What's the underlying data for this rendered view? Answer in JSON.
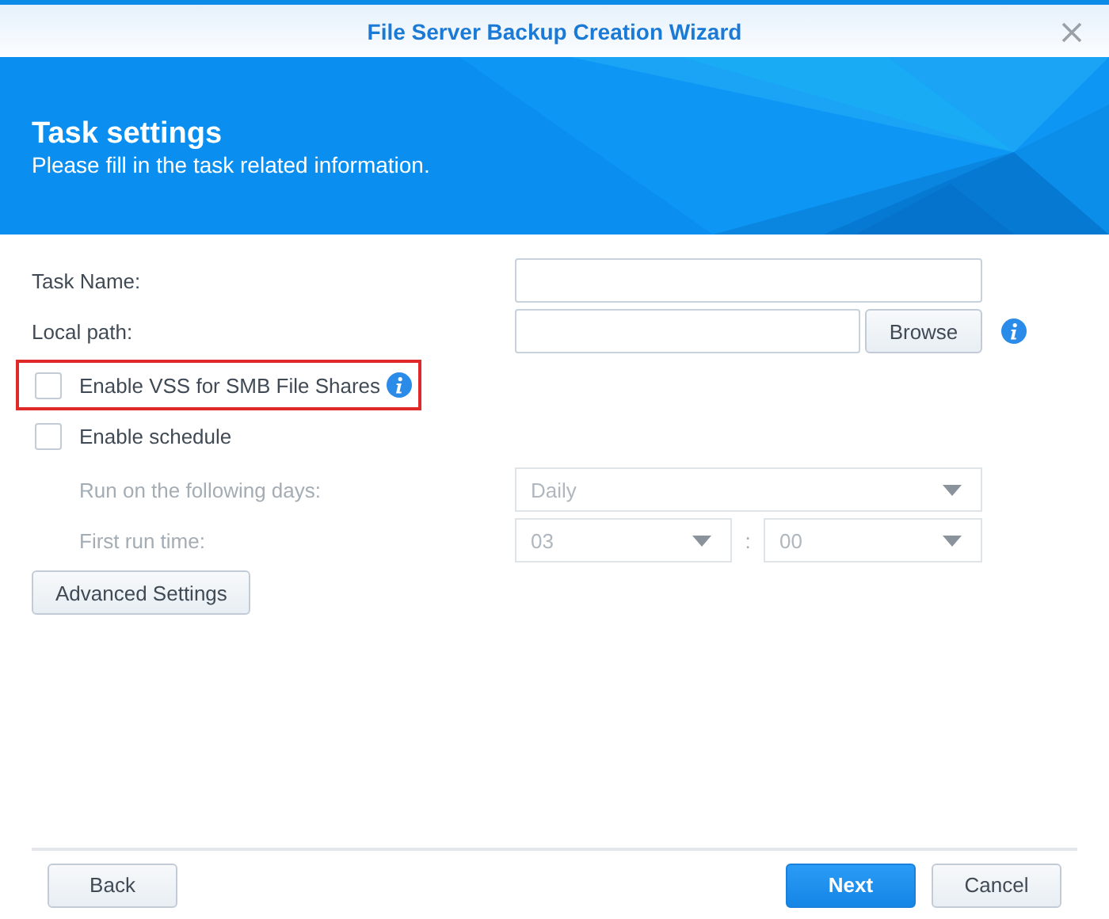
{
  "window": {
    "title": "File Server Backup Creation Wizard"
  },
  "header": {
    "title": "Task settings",
    "subtitle": "Please fill in the task related information."
  },
  "fields": [
    {
      "kind": "text",
      "label": "Task Name:",
      "info": false
    },
    {
      "kind": "path",
      "label": "Local path:",
      "button": "Browse",
      "info": true
    }
  ],
  "checkboxes": [
    {
      "label": "Enable VSS for SMB File Shares",
      "checked": false,
      "info": true,
      "highlighted": true
    },
    {
      "label": "Enable schedule",
      "checked": false,
      "info": false,
      "highlighted": false
    }
  ],
  "schedule": {
    "disabled": true,
    "days": {
      "label": "Run on the following days:",
      "value": "Daily"
    },
    "time": {
      "label": "First run time:",
      "hour": "03",
      "separator": ":",
      "minute": "00"
    }
  },
  "advanced_button": "Advanced Settings",
  "footer": {
    "back": "Back",
    "next": "Next",
    "cancel": "Cancel"
  }
}
